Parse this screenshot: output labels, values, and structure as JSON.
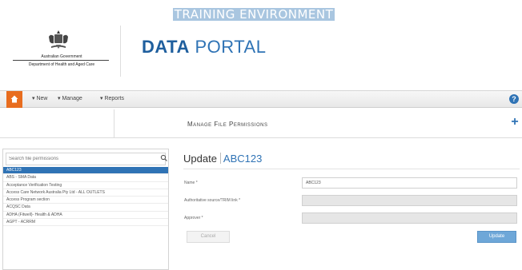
{
  "header": {
    "banner": "TRAINING ENVIRONMENT",
    "gov_line1": "Australian Government",
    "gov_line2": "Department of Health and Aged Care",
    "brand_bold": "DATA",
    "brand_light": "PORTAL"
  },
  "navbar": {
    "items": [
      {
        "label": "▾ New"
      },
      {
        "label": "▾ Manage"
      },
      {
        "label": "▾ Reports"
      }
    ],
    "help": "?"
  },
  "subbar": {
    "title": "Manage File Permissions",
    "plus": "+"
  },
  "sidebar": {
    "search_placeholder": "Search file permissions",
    "items": [
      {
        "label": "ABC123",
        "selected": true
      },
      {
        "label": "ABS - SMA Data"
      },
      {
        "label": "Acceptance Verification Testing"
      },
      {
        "label": "Access Care Network Australia Pty Ltd - ALL OUTLETS"
      },
      {
        "label": "Access Program section"
      },
      {
        "label": "ACQSC Data"
      },
      {
        "label": "ADHA (Fitwell)- Health & ADHA"
      },
      {
        "label": "AGPT - ACRRM"
      }
    ]
  },
  "main": {
    "title_action": "Update",
    "title_record": "ABC123",
    "form": {
      "name_label": "Name *",
      "name_value": "ABC123",
      "auth_label": "Authoritative source/TRIM link *",
      "auth_value": "",
      "approver_label": "Approver *",
      "approver_value": ""
    },
    "cancel_label": "Cancel",
    "update_label": "Update"
  },
  "colors": {
    "accent": "#2f73b5",
    "home": "#e86d1f",
    "banner": "#a9c6e0"
  }
}
